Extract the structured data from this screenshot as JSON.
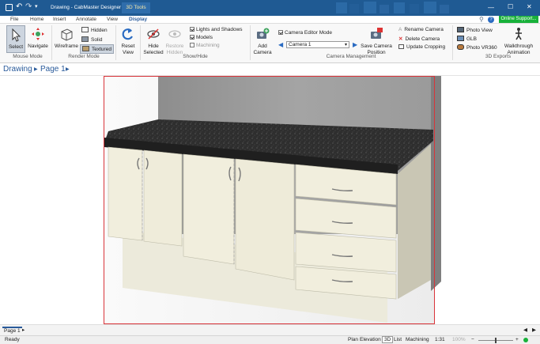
{
  "titlebar": {
    "title": "Drawing - CabMaster Designer",
    "context_tab": "3D Tools",
    "minimize": "—",
    "maximize": "☐",
    "close": "✕"
  },
  "tabs": [
    "File",
    "Home",
    "Insert",
    "Annotate",
    "View",
    "Display"
  ],
  "online_support": "Online Support...",
  "ribbon": {
    "mouse_mode": {
      "label": "Mouse Mode",
      "select": "Select",
      "navigate": "Navigate"
    },
    "render_mode": {
      "label": "Render Mode",
      "wireframe": "Wireframe",
      "hidden": "Hidden",
      "solid": "Solid",
      "textured": "Textured"
    },
    "reset_view": {
      "line1": "Reset",
      "line2": "View"
    },
    "show_hide": {
      "label": "Show/Hide",
      "hide_selected": {
        "line1": "Hide",
        "line2": "Selected"
      },
      "restore_hidden": {
        "line1": "Restore",
        "line2": "Hidden"
      },
      "lights_and_shadows": "Lights and Shadows",
      "models": "Models",
      "machining": "Machining"
    },
    "camera": {
      "label": "Camera Management",
      "add_camera": {
        "line1": "Add",
        "line2": "Camera"
      },
      "camera_editor_mode": "Camera Editor Mode",
      "camera_select": "Camera 1",
      "save_camera_position": {
        "line1": "Save Camera",
        "line2": "Position"
      },
      "rename_camera": "Rename Camera",
      "delete_camera": "Delete Camera",
      "update_cropping": "Update Cropping"
    },
    "exports": {
      "label": "3D Exports",
      "photo_view": "Photo View",
      "glb": "GLB",
      "photo_vr360": "Photo VR360",
      "walkthrough": {
        "line1": "Walkthrough",
        "line2": "Animation"
      }
    }
  },
  "breadcrumb": {
    "root": "Drawing",
    "page": "Page 1"
  },
  "page_tabs": {
    "active": "Page 1"
  },
  "statusbar": {
    "status": "Ready",
    "plan": "Plan",
    "elevation": "Elevation",
    "three_d": "3D",
    "list": "List",
    "machining": "Machining",
    "scale": "1:31",
    "zoom": "100%"
  },
  "colors": {
    "titlebar": "#1f5a93",
    "accent": "#2a5b9b",
    "online_support_bg": "#18b13a",
    "cabinet": "#f1eedd",
    "countertop": "#2c2c2c",
    "selection_frame": "#d9343a"
  }
}
